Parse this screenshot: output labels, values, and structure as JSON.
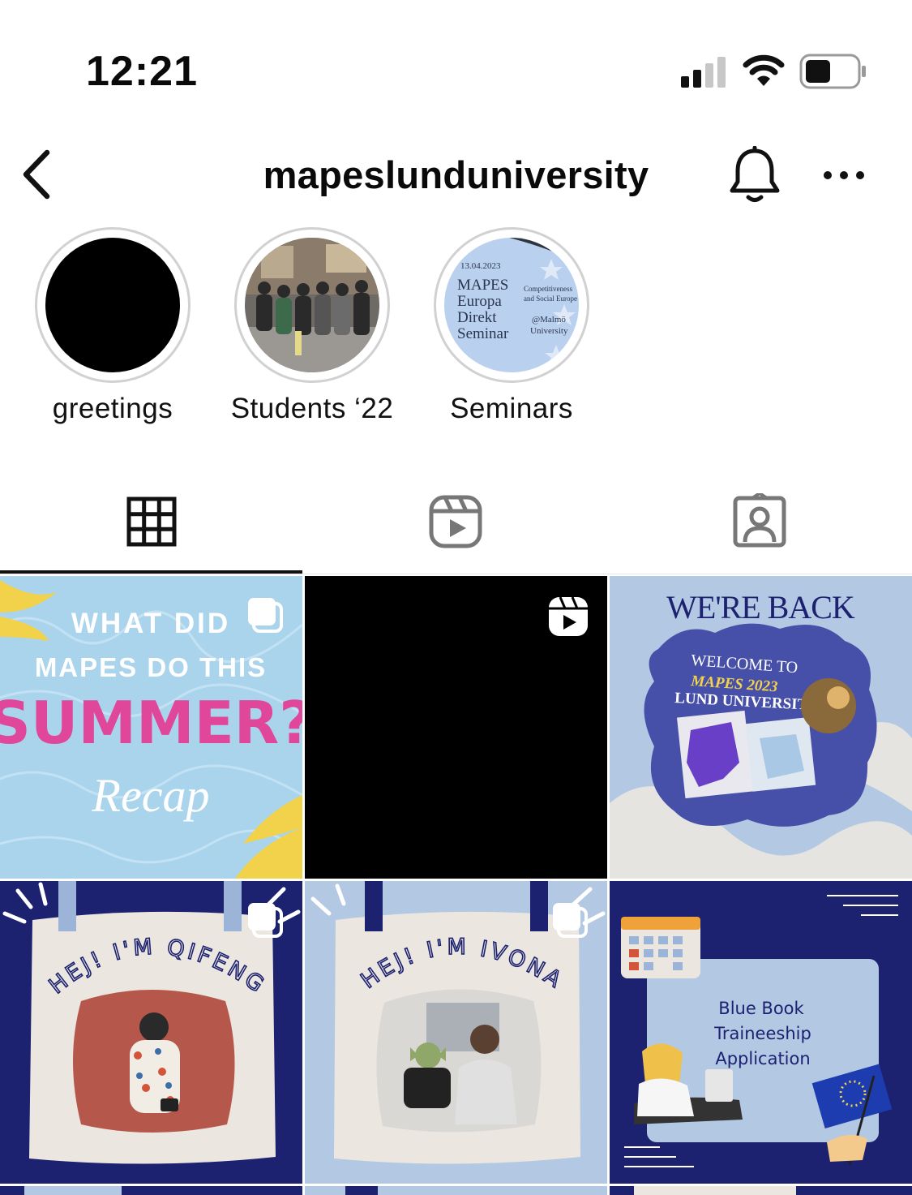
{
  "status_bar": {
    "time": "12:21",
    "icons": [
      "cellular-signal-icon",
      "wifi-icon",
      "battery-icon"
    ]
  },
  "header": {
    "username": "mapeslunduniversity",
    "icons": [
      "back-chevron-icon",
      "bell-icon",
      "more-dots-icon"
    ]
  },
  "highlights": [
    {
      "label": "greetings"
    },
    {
      "label": "Students ‘22"
    },
    {
      "label": "Seminars",
      "cover_text": {
        "date": "13.04.2023",
        "title_lines": [
          "MAPES",
          "Europa",
          "Direkt",
          "Seminar"
        ],
        "topic_lines": [
          "Competitiveness",
          "and Social Europe"
        ],
        "venue_lines": [
          "@Malmö",
          "University"
        ]
      }
    }
  ],
  "tabs": [
    {
      "name": "posts",
      "icon": "grid-icon",
      "selected": true
    },
    {
      "name": "reels",
      "icon": "reels-icon",
      "selected": false
    },
    {
      "name": "tagged",
      "icon": "tagged-user-icon",
      "selected": false
    }
  ],
  "posts": [
    {
      "type": "carousel",
      "badge_icon": "carousel-icon",
      "lines": [
        "WHAT DID",
        "MAPES DO THIS",
        "SUMMER?",
        "Recap"
      ]
    },
    {
      "type": "reel",
      "badge_icon": "reel-icon",
      "lines": []
    },
    {
      "type": "image",
      "lines": [
        "WE'RE BACK",
        "WELCOME TO",
        "MAPES 2023",
        "LUND UNIVERSITY!"
      ]
    },
    {
      "type": "carousel",
      "badge_icon": "carousel-icon",
      "lines": [
        "HEJ! I'M QIFENG"
      ]
    },
    {
      "type": "carousel",
      "badge_icon": "carousel-icon",
      "lines": [
        "HEJ! I'M IVONA"
      ]
    },
    {
      "type": "image",
      "lines": [
        "Blue Book",
        "Traineeship",
        "Application"
      ]
    }
  ],
  "colors": {
    "navy": "#1c2170",
    "light_blue": "#b3c8e2",
    "pink": "#e0479b",
    "cream": "#ebe7e0",
    "pool_blue": "#a9d4ec"
  }
}
